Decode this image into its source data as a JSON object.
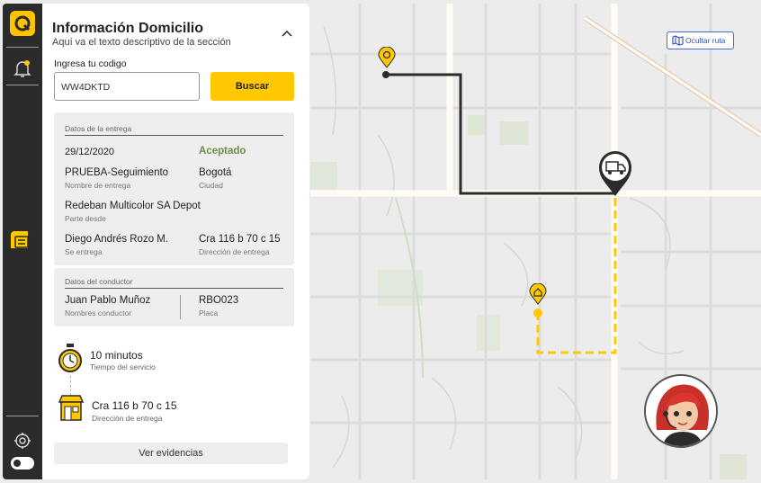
{
  "sidebar": {
    "logo_icon": "quick-logo-icon",
    "items": [
      {
        "icon": "bell-icon"
      },
      {
        "icon": "card-icon",
        "active": true
      },
      {
        "icon": "settings-icon"
      },
      {
        "icon": "toggle-switch"
      }
    ]
  },
  "panel": {
    "title": "Información Domicilio",
    "subtitle": "Aquí va el texto descriptivo de la sección",
    "code_label": "Ingresa tu codigo",
    "code_value": "WW4DKTD",
    "search_button": "Buscar",
    "delivery": {
      "section_title": "Datos de la entrega",
      "date": "29/12/2020",
      "status": "Aceptado",
      "delivery_name": "PRUEBA-Seguimiento",
      "delivery_name_label": "Nombre de entrega",
      "city": "Bogotá",
      "city_label": "Ciudad",
      "origin": "Redeban Multicolor SA Depot",
      "origin_label": "Parte desde",
      "sender": "Diego Andrés Rozo M.",
      "sender_label": "Se entrega",
      "address": "Cra 116 b 70 c 15",
      "address_label": "Dirección de entrega"
    },
    "driver": {
      "section_title": "Datos del conductor",
      "name": "Juan Pablo Muñoz",
      "name_label": "Nombres conductor",
      "plate": "RBO023",
      "plate_label": "Placa"
    },
    "timeline": {
      "time_value": "10 minutos",
      "time_label": "Tiempo del servicio",
      "address_value": "Cra 116 b 70 c 15",
      "address_label": "Dirección de entrega"
    },
    "evidence_button": "Ver evidencias"
  },
  "map": {
    "hide_route_button": "Ocultar ruta",
    "colors": {
      "accent": "#ffc800",
      "route": "#2b2b2b",
      "background": "#ececec"
    }
  }
}
